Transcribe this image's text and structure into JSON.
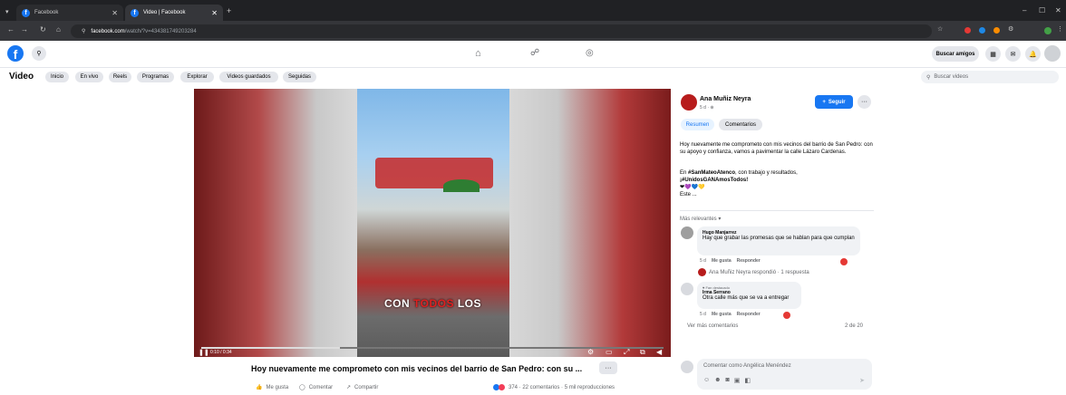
{
  "browser": {
    "tabs": [
      {
        "label": "Facebook",
        "active": false
      },
      {
        "label": "Video | Facebook",
        "active": true
      }
    ],
    "new_tab": "+",
    "url_host": "facebook.com",
    "url_path": "/watch/?v=434381749203284",
    "window_controls": [
      "–",
      "☐",
      "✕"
    ]
  },
  "header": {
    "logo": "f",
    "nav_icons": [
      "home-icon",
      "friends-icon",
      "groups-icon"
    ],
    "find_friends_label": "Buscar amigos"
  },
  "video_nav": {
    "title": "Video",
    "tabs": [
      "Inicio",
      "En vivo",
      "Reels",
      "Programas",
      "Explorar",
      "Videos guardados",
      "Seguidas"
    ],
    "search_placeholder": "Buscar videos"
  },
  "player": {
    "caption_words": [
      "CON",
      "TODOS",
      "LOS"
    ],
    "time": "0:10 / 0:34",
    "progress": 0.3
  },
  "post": {
    "title": "Hoy nuevamente me comprometo con mis vecinos del barrio de San Pedro: con su ...",
    "actions": [
      "Me gusta",
      "Comentar",
      "Compartir"
    ],
    "stats": "374 · 22 comentarios · 5 mil reproducciones"
  },
  "panel": {
    "author": "Ana Muñiz Neyra",
    "time": "5 d",
    "follow_label": "Seguir",
    "tabs": [
      "Resumen",
      "Comentarios"
    ],
    "body_1": "Hoy nuevamente me comprometo con mis vecinos del barrio de San Pedro: con su apoyo y confianza, vamos a pavimentar la calle Lázaro Cardenas.",
    "body_2_prefix": "En ",
    "hashtag_1": "#SanMateoAtenco",
    "body_2_suffix": ", con trabajo y resultados,",
    "hashtag_2": "¡#UnidosGANAmosTodos!",
    "hearts": "❤💜💙💛",
    "see_more": "Este ...",
    "sort_label": "Más relevantes ▾",
    "comments": [
      {
        "name": "Hugo Manjarrez",
        "text": "Hay que grabar las promesas que se hablan para que cumplan",
        "time": "5 d",
        "like": "Me gusta",
        "reply": "Responder"
      },
      {
        "badge": "♥ Fan destacado",
        "name": "Irma Serrano",
        "text": "Otra calle más que se va a entregar",
        "time": "5 d",
        "like": "Me gusta",
        "reply": "Responder"
      }
    ],
    "reply_note": "Ana Muñiz Neyra respondió · 1 respuesta",
    "more_comments": "Ver más comentarios",
    "count": "2 de 20",
    "comment_placeholder": "Comentar como Angélica Menéndez"
  }
}
